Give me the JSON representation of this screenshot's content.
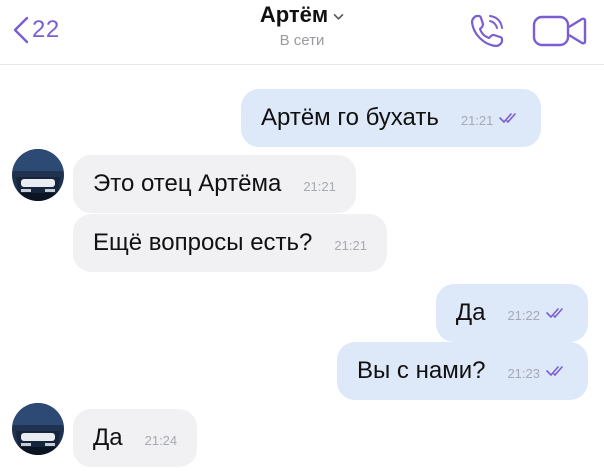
{
  "header": {
    "back_count": "22",
    "contact_name": "Артём",
    "status": "В сети"
  },
  "messages": [
    {
      "direction": "out",
      "text": "Артём го бухать",
      "time": "21:21",
      "read": true
    },
    {
      "direction": "in",
      "text": "Это отец Артёма",
      "time": "21:21",
      "avatar": true
    },
    {
      "direction": "in",
      "text": "Ещё вопросы есть?",
      "time": "21:21",
      "avatar": false
    },
    {
      "direction": "out",
      "text": "Да",
      "time": "21:22",
      "read": true
    },
    {
      "direction": "out",
      "text": "Вы с нами?",
      "time": "21:23",
      "read": true
    },
    {
      "direction": "in",
      "text": "Да",
      "time": "21:24",
      "avatar": true
    }
  ],
  "colors": {
    "accent": "#7b5fd0",
    "outgoing_bubble": "#dde8f8",
    "incoming_bubble": "#f1f1f3",
    "status_text": "#9a9aa0"
  },
  "icons": {
    "back": "chevron-left-icon",
    "title_dropdown": "chevron-down-icon",
    "call": "phone-icon",
    "video": "video-camera-icon",
    "read_receipt": "double-check-icon",
    "avatar": "car-avatar-icon"
  }
}
